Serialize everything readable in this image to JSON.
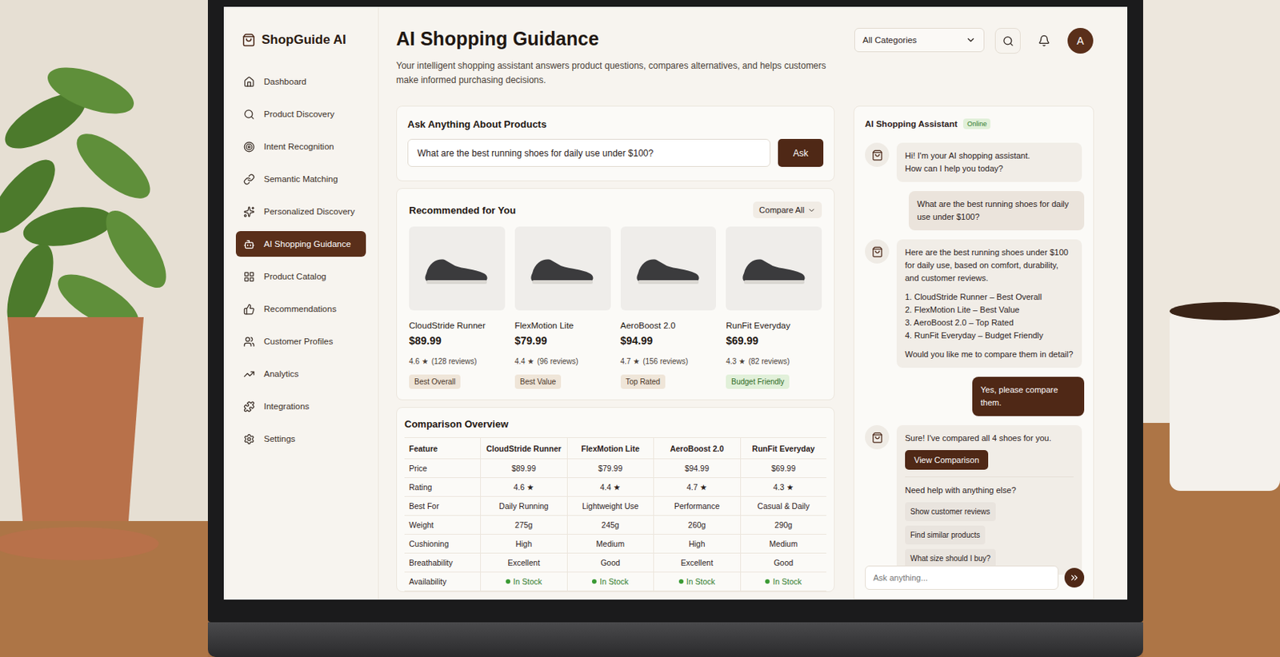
{
  "brand": {
    "name": "ShopGuide AI"
  },
  "sidebar": {
    "items": [
      {
        "label": "Dashboard",
        "selected": false
      },
      {
        "label": "Product Discovery",
        "selected": false
      },
      {
        "label": "Intent Recognition",
        "selected": false
      },
      {
        "label": "Semantic Matching",
        "selected": false
      },
      {
        "label": "Personalized Discovery",
        "selected": false
      },
      {
        "label": "AI Shopping Guidance",
        "selected": true
      },
      {
        "label": "Product Catalog",
        "selected": false
      },
      {
        "label": "Recommendations",
        "selected": false
      },
      {
        "label": "Customer Profiles",
        "selected": false
      },
      {
        "label": "Analytics",
        "selected": false
      },
      {
        "label": "Integrations",
        "selected": false
      },
      {
        "label": "Settings",
        "selected": false
      }
    ]
  },
  "header": {
    "title": "AI Shopping Guidance",
    "description": "Your intelligent shopping assistant answers product questions, compares alternatives, and helps customers make informed purchasing decisions.",
    "category": "All Categories",
    "avatar": "A"
  },
  "ask": {
    "title": "Ask Anything About Products",
    "value": "What are the best running shoes for daily use under $100?",
    "button": "Ask"
  },
  "recommended": {
    "title": "Recommended for You",
    "compare": "Compare All",
    "products": [
      {
        "name": "CloudStride Runner",
        "price": "$89.99",
        "rating": "4.6 ★",
        "reviews": "(128 reviews)",
        "badge": "Best Overall",
        "kind": "neutral"
      },
      {
        "name": "FlexMotion Lite",
        "price": "$79.99",
        "rating": "4.4 ★",
        "reviews": "(96 reviews)",
        "badge": "Best Value",
        "kind": "neutral"
      },
      {
        "name": "AeroBoost 2.0",
        "price": "$94.99",
        "rating": "4.7 ★",
        "reviews": "(156 reviews)",
        "badge": "Top Rated",
        "kind": "neutral"
      },
      {
        "name": "RunFit Everyday",
        "price": "$69.99",
        "rating": "4.3 ★",
        "reviews": "(82 reviews)",
        "badge": "Budget Friendly",
        "kind": "success"
      }
    ]
  },
  "comparison": {
    "title": "Comparison Overview",
    "columns": [
      "Feature",
      "CloudStride Runner",
      "FlexMotion Lite",
      "AeroBoost 2.0",
      "RunFit Everyday"
    ],
    "rows": [
      {
        "kind": "text",
        "cells": [
          "Price",
          "$89.99",
          "$79.99",
          "$94.99",
          "$69.99"
        ]
      },
      {
        "kind": "text",
        "cells": [
          "Rating",
          "4.6 ★",
          "4.4 ★",
          "4.7 ★",
          "4.3 ★"
        ]
      },
      {
        "kind": "text",
        "cells": [
          "Best For",
          "Daily Running",
          "Lightweight Use",
          "Performance",
          "Casual & Daily"
        ]
      },
      {
        "kind": "text",
        "cells": [
          "Weight",
          "275g",
          "245g",
          "260g",
          "290g"
        ]
      },
      {
        "kind": "text",
        "cells": [
          "Cushioning",
          "High",
          "Medium",
          "High",
          "Medium"
        ]
      },
      {
        "kind": "text",
        "cells": [
          "Breathability",
          "Excellent",
          "Good",
          "Excellent",
          "Good"
        ]
      },
      {
        "kind": "status",
        "cells": [
          "Availability",
          "In Stock",
          "In Stock",
          "In Stock",
          "In Stock"
        ]
      }
    ]
  },
  "chat": {
    "title": "AI Shopping Assistant",
    "status": "Online",
    "placeholder": "Ask anything...",
    "messages": [
      {
        "kind": "text",
        "lines": [
          "Hi! I'm your AI shopping assistant.",
          "How can I help you today?"
        ]
      },
      {
        "kind": "question",
        "lines": [
          "What are the best running shoes for daily use under $100?"
        ]
      },
      {
        "kind": "list",
        "intro": "Here are the best running shoes under $100 for daily use, based on comfort, durability, and customer reviews.",
        "items": [
          "1. CloudStride Runner – Best Overall",
          "2. FlexMotion Lite – Best Value",
          "3. AeroBoost 2.0 – Top Rated",
          "4. RunFit Everyday – Budget Friendly"
        ],
        "outro": "Would you like me to compare them in detail?"
      },
      {
        "kind": "reply",
        "lines": [
          "Yes, please compare them."
        ]
      },
      {
        "kind": "action",
        "intro": "Sure! I've compared all 4 shoes for you.",
        "button": "View Comparison",
        "outro": "Need help with anything else?",
        "chips": [
          "Show customer reviews",
          "Find similar products",
          "What size should I buy?"
        ]
      }
    ]
  }
}
